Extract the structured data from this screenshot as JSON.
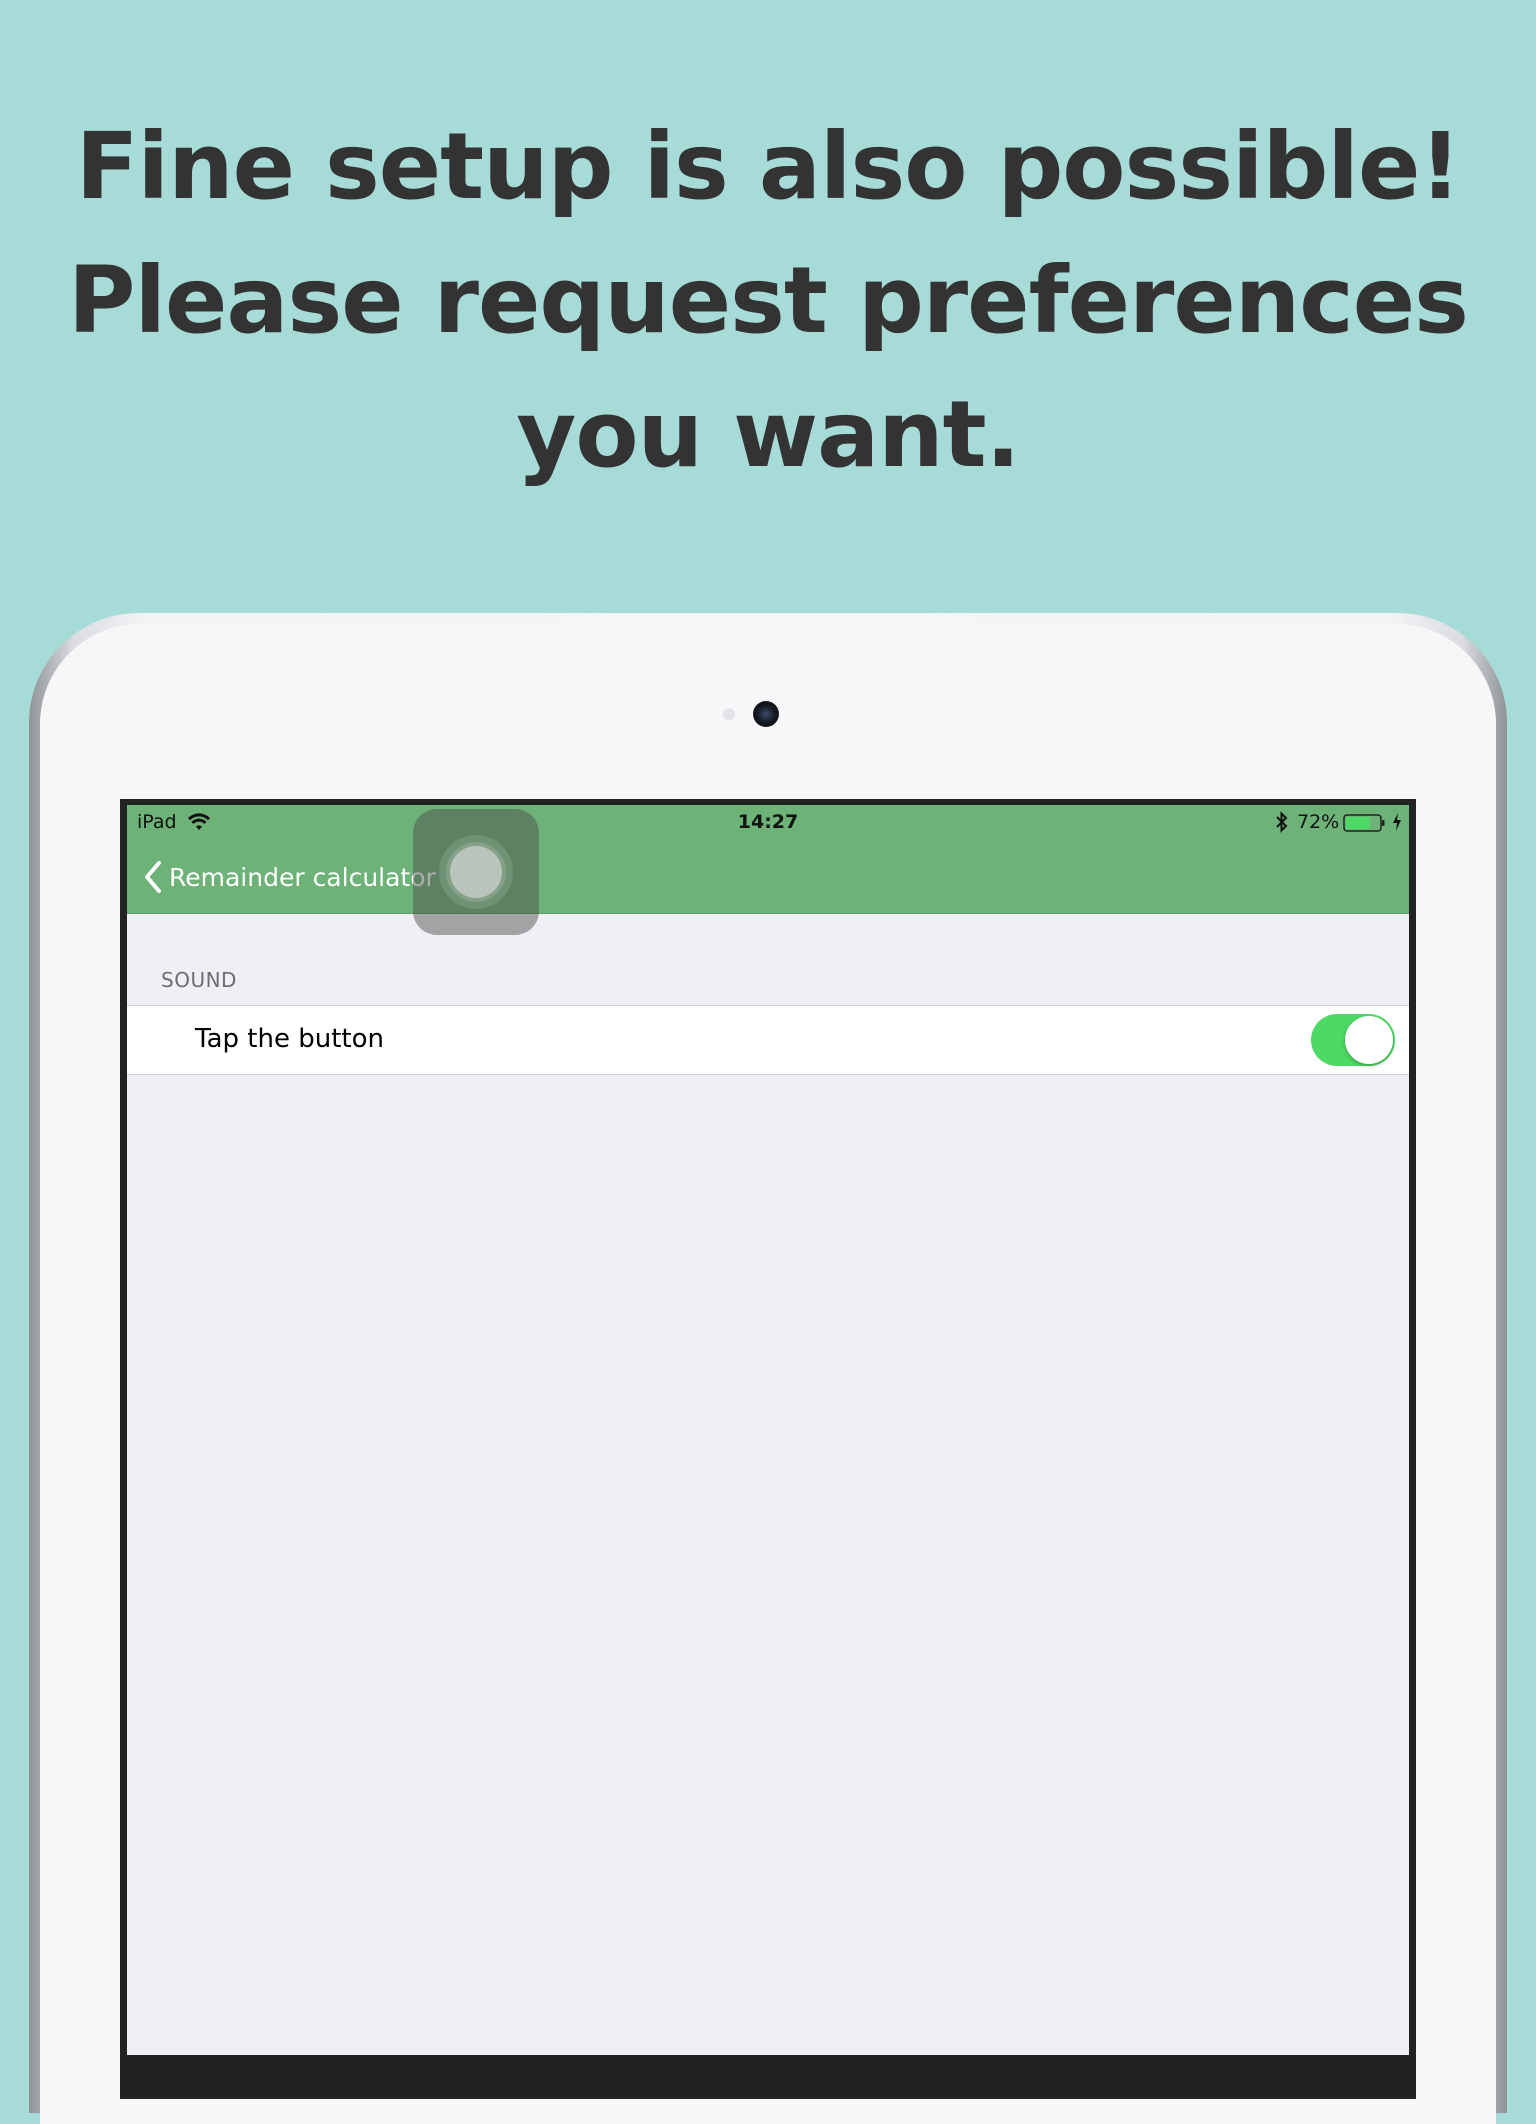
{
  "headline": {
    "line1": "Fine setup is also possible!",
    "line2": "Please request preferences",
    "line3": "you want."
  },
  "status_bar": {
    "carrier": "iPad",
    "time": "14:27",
    "battery_percent": "72%",
    "battery_level": 0.72,
    "icons": [
      "wifi-icon",
      "bluetooth-icon",
      "battery-icon",
      "charging-icon"
    ]
  },
  "nav": {
    "back_label": "Remainder calculator"
  },
  "settings": {
    "sections": [
      {
        "header": "SOUND",
        "rows": [
          {
            "label": "Tap the button",
            "toggle_on": true
          }
        ]
      }
    ]
  },
  "colors": {
    "background": "#a7dbd8",
    "navbar": "#6db277",
    "toggle_on": "#4cd964",
    "headline_text": "#333333"
  }
}
